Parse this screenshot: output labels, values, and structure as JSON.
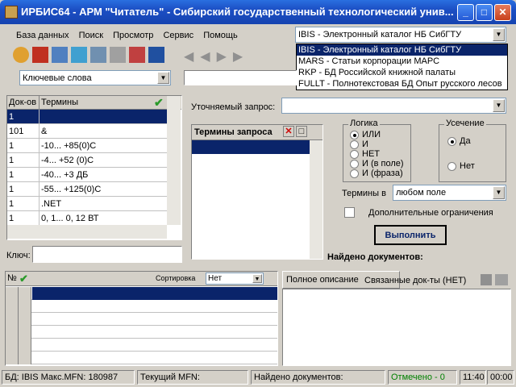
{
  "window": {
    "title": "ИРБИС64 - АРМ \"Читатель\" - Сибирский государственный технологический унив...",
    "min": "_",
    "max": "□",
    "close": "✕"
  },
  "menu": [
    "База данных",
    "Поиск",
    "Просмотр",
    "Сервис",
    "Помощь"
  ],
  "db_select": {
    "value": "IBIS - Электронный каталог НБ СибГТУ",
    "options": [
      "IBIS - Электронный каталог НБ СибГТУ",
      "MARS - Статьи корпорации МАРС",
      "RKP - БД Российской книжной палаты",
      "FULLT - Полнотекстовая БД Опыт русского лесов"
    ]
  },
  "search_mode": {
    "value": "Ключевые слова"
  },
  "terms_table": {
    "headers": [
      "Док-ов",
      "Термины"
    ],
    "rows": [
      [
        "1",
        ""
      ],
      [
        "101",
        "&"
      ],
      [
        "1",
        "-10... +85(0)С"
      ],
      [
        "1",
        "-4... +52 (0)С"
      ],
      [
        "1",
        "-40... +3 ДБ"
      ],
      [
        "1",
        "-55... +125(0)С"
      ],
      [
        "1",
        ".NET"
      ],
      [
        "1",
        "0, 1... 0, 12 ВТ"
      ]
    ]
  },
  "key_label": "Ключ:",
  "refine_label": "Уточняемый запрос:",
  "query_terms": {
    "header": "Термины запроса"
  },
  "logic": {
    "title": "Логика",
    "options": [
      "ИЛИ",
      "И",
      "НЕТ",
      "И (в поле)",
      "И (фраза)"
    ],
    "selected": 0
  },
  "truncation": {
    "title": "Усечение",
    "options": [
      "Да",
      "Нет"
    ],
    "selected": 0
  },
  "terms_in": {
    "label": "Термины в",
    "value": "любом поле"
  },
  "extra": {
    "label": "Дополнительные ограничения"
  },
  "execute_label": "Выполнить",
  "found_label": "Найдено документов:",
  "results": {
    "num_header": "№",
    "sort_label": "Сортировка",
    "sort_value": "Нет"
  },
  "tabs": [
    "Полное описание",
    "Связанные док-ты (НЕТ)"
  ],
  "status": {
    "db": "БД: IBIS Макс.MFN: 180987",
    "mfn": "Текущий MFN:",
    "found": "Найдено документов:",
    "marked": "Отмечено - 0",
    "time": "11:40",
    "time2": "00:00"
  },
  "colors": {
    "title": "#1c4fc4",
    "selection": "#0a246a",
    "marked": "#008000"
  }
}
